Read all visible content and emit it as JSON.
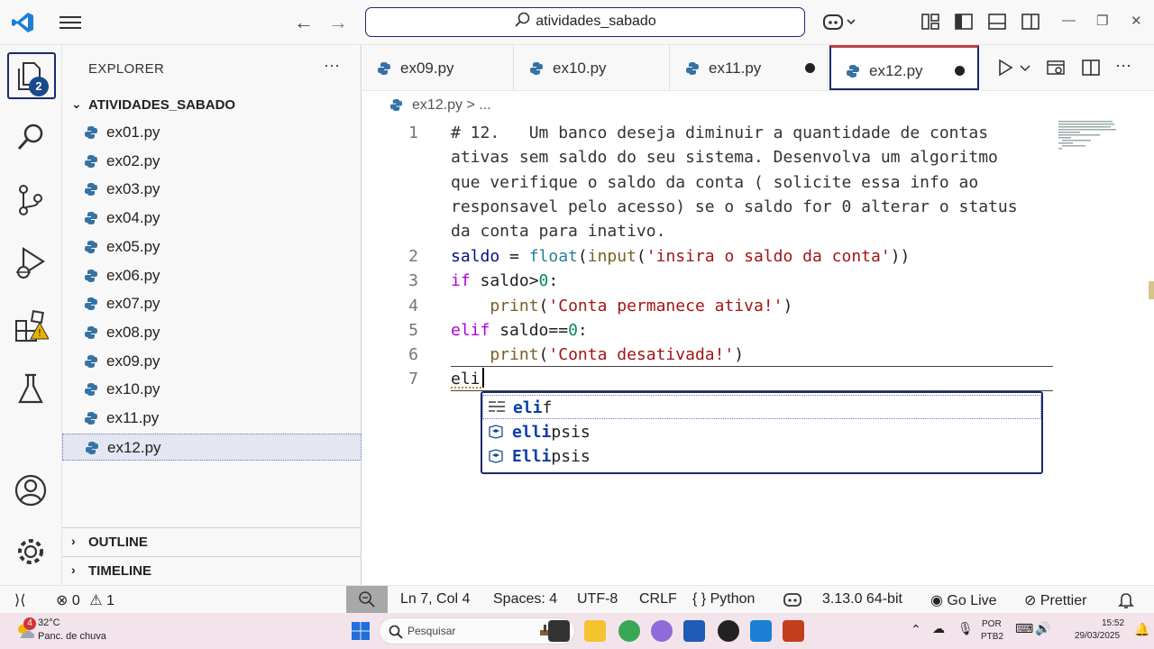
{
  "titlebar": {
    "search_text": "atividades_sabado",
    "back_arrow": "←",
    "forward_arrow": "→",
    "minimize": "—",
    "restore": "❐",
    "close": "✕"
  },
  "activitybar": {
    "explorer_badge": "2",
    "items": [
      "files-icon",
      "search-icon",
      "source-control-icon",
      "run-debug-icon",
      "extensions-icon",
      "testing-icon",
      "account-icon",
      "settings-icon"
    ]
  },
  "sidebar": {
    "header": "EXPLORER",
    "more": "···",
    "folder_name": "ATIVIDADES_SABADO",
    "files": [
      "ex01.py",
      "ex02.py",
      "ex03.py",
      "ex04.py",
      "ex05.py",
      "ex06.py",
      "ex07.py",
      "ex08.py",
      "ex09.py",
      "ex10.py",
      "ex11.py",
      "ex12.py"
    ],
    "selected_file": "ex12.py",
    "outline_label": "OUTLINE",
    "timeline_label": "TIMELINE"
  },
  "tabs": [
    {
      "label": "ex09.py",
      "dirty": false,
      "active": false
    },
    {
      "label": "ex10.py",
      "dirty": false,
      "active": false
    },
    {
      "label": "ex11.py",
      "dirty": true,
      "active": false
    },
    {
      "label": "ex12.py",
      "dirty": true,
      "active": true
    }
  ],
  "tab_actions": {
    "more": "···"
  },
  "breadcrumb": {
    "file": "ex12.py",
    "sep": ">",
    "more": "..."
  },
  "editor": {
    "line_numbers": [
      "1",
      "2",
      "3",
      "4",
      "5",
      "6",
      "7"
    ],
    "comment_lines": [
      "# 12.   Um banco deseja diminuir a quantidade de contas",
      "ativas sem saldo do seu sistema. Desenvolva um algoritmo",
      "que verifique o saldo da conta ( solicite essa info ao",
      "responsavel pelo acesso) se o saldo for 0 alterar o status",
      "da conta para inativo."
    ],
    "line2": {
      "var": "saldo",
      "op": " = ",
      "fn1": "float",
      "p1": "(",
      "fn2": "input",
      "p2": "(",
      "str": "'insira o saldo da conta'",
      "p3": "))"
    },
    "line3": {
      "kw": "if",
      "rest": " saldo>",
      "num": "0",
      "colon": ":"
    },
    "line4": {
      "indent": "    ",
      "fn": "print",
      "p1": "(",
      "str": "'Conta permanece ativa!'",
      "p2": ")"
    },
    "line5": {
      "kw": "elif",
      "rest": " saldo==",
      "num": "0",
      "colon": ":"
    },
    "line6": {
      "indent": "    ",
      "fn": "print",
      "p1": "(",
      "str": "'Conta desativada!'",
      "p2": ")"
    },
    "line7": "eli"
  },
  "suggest": {
    "items": [
      {
        "match": "eli",
        "rest": "f",
        "kind": "keyword-icon"
      },
      {
        "match": "elli",
        "rest": "psis",
        "kind": "variable-icon"
      },
      {
        "match": "Elli",
        "rest": "psis",
        "kind": "variable-icon"
      }
    ]
  },
  "statusbar": {
    "remote": "⟩⟨",
    "errors": "0",
    "warnings": "1",
    "position": "Ln 7, Col 4",
    "spaces": "Spaces: 4",
    "encoding": "UTF-8",
    "eol": "CRLF",
    "language": "{ } Python",
    "interpreter": "3.13.0 64-bit",
    "golive": "Go Live",
    "prettier": "Prettier"
  },
  "taskbar": {
    "weather_badge": "4",
    "temperature": "32°C",
    "weather_desc": "Panc. de chuva",
    "search_placeholder": "Pesquisar",
    "lang1": "POR",
    "lang2": "PTB2",
    "time": "15:52",
    "date": "29/03/2025"
  }
}
